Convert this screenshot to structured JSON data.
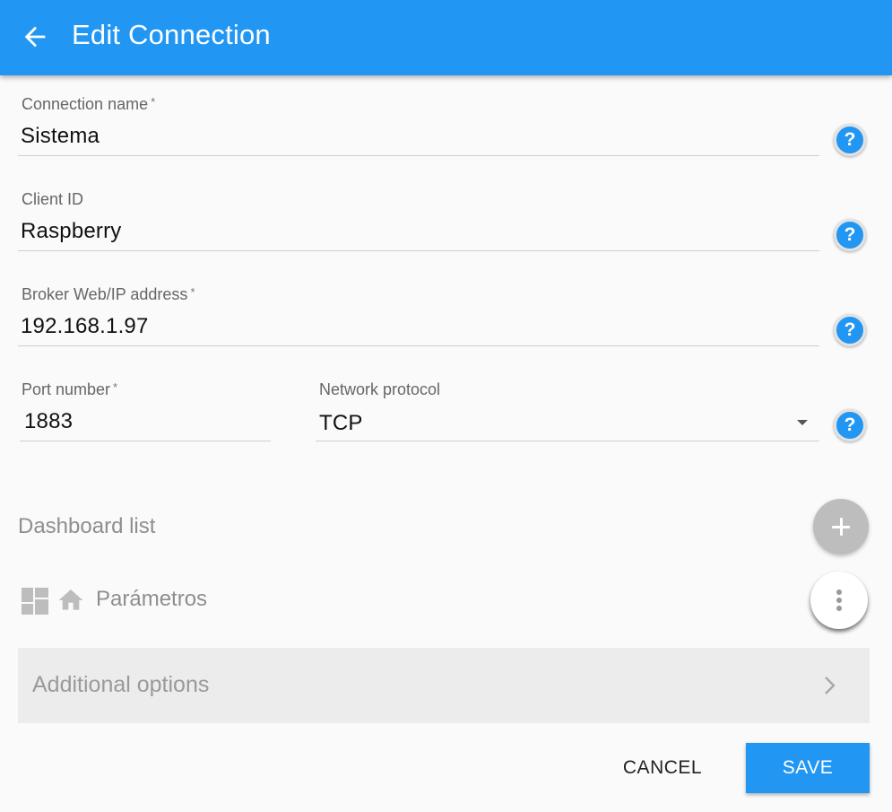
{
  "appbar": {
    "title": "Edit Connection",
    "back_icon": "arrow-left-icon",
    "color": "#2196f3"
  },
  "form": {
    "connection_name": {
      "label": "Connection name",
      "required_mark": "*",
      "value": "Sistema"
    },
    "client_id": {
      "label": "Client ID",
      "value": "Raspberry"
    },
    "broker_address": {
      "label": "Broker Web/IP address",
      "required_mark": "*",
      "value": "192.168.1.97"
    },
    "port_number": {
      "label": "Port number",
      "required_mark": "*",
      "value": "1883"
    },
    "network_protocol": {
      "label": "Network protocol",
      "value": "TCP"
    },
    "help_icon": "?"
  },
  "dashboards": {
    "title": "Dashboard list",
    "items": [
      {
        "name": "Parámetros",
        "icons": [
          "dashboard-icon",
          "home-icon"
        ]
      }
    ]
  },
  "additional_options": {
    "label": "Additional options"
  },
  "actions": {
    "cancel_label": "CANCEL",
    "save_label": "SAVE"
  }
}
